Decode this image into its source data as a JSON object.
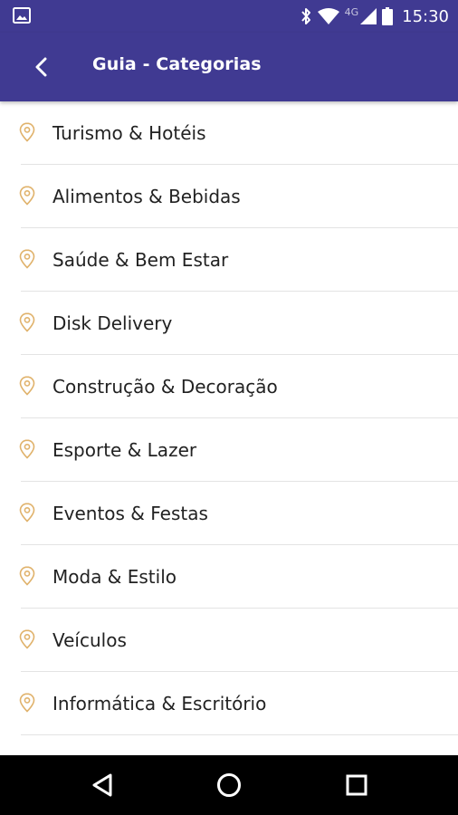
{
  "status_bar": {
    "network": "4G",
    "time": "15:30"
  },
  "app_bar": {
    "title": "Guia - Categorias"
  },
  "categories": [
    {
      "label": "Turismo & Hotéis"
    },
    {
      "label": "Alimentos & Bebidas"
    },
    {
      "label": "Saúde & Bem Estar"
    },
    {
      "label": "Disk Delivery"
    },
    {
      "label": "Construção & Decoração"
    },
    {
      "label": "Esporte & Lazer"
    },
    {
      "label": "Eventos & Festas"
    },
    {
      "label": "Moda & Estilo"
    },
    {
      "label": "Veículos"
    },
    {
      "label": "Informática & Escritório"
    }
  ],
  "colors": {
    "primary": "#403a92",
    "pin": "#e0b26b",
    "text": "#222222",
    "divider": "#e3e3e3"
  },
  "icons": {
    "status_left": "image-icon",
    "item": "map-pin-icon",
    "back": "chevron-left-icon",
    "nav": [
      "back-triangle-icon",
      "home-circle-icon",
      "recents-square-icon"
    ]
  }
}
